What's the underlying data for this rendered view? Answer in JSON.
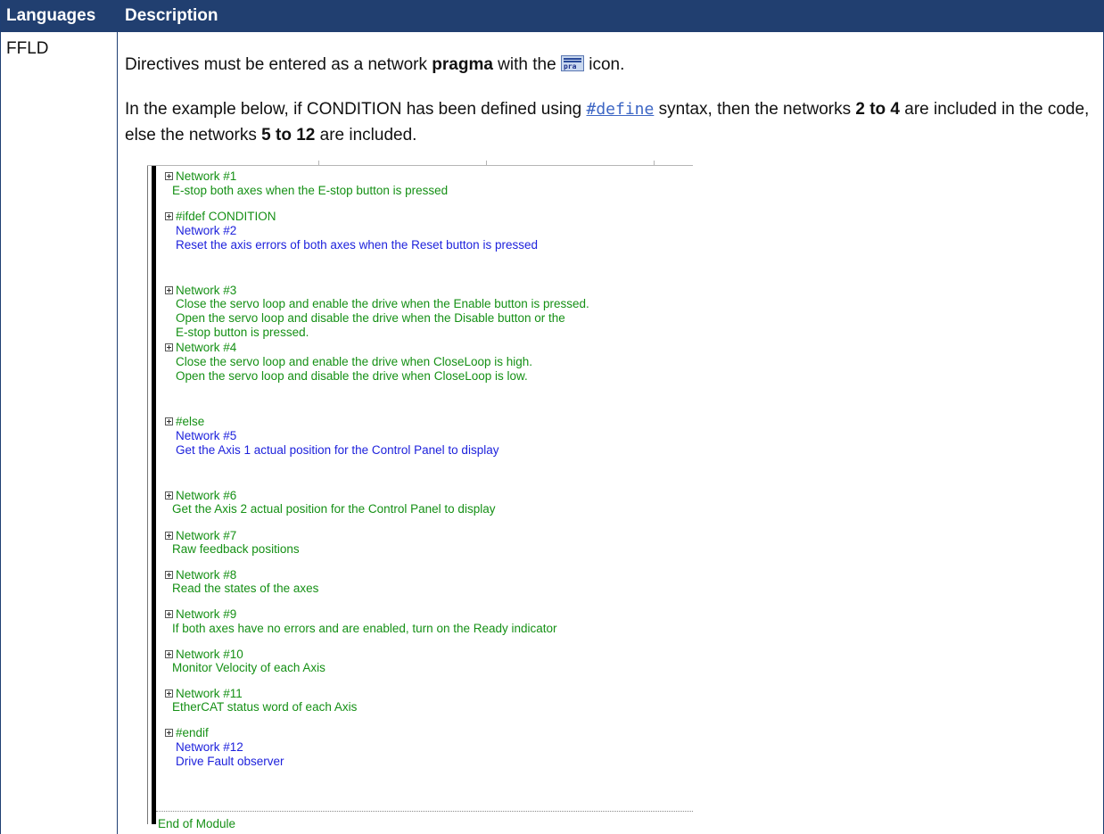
{
  "table": {
    "headers": [
      "Languages",
      "Description"
    ],
    "language": "FFLD",
    "p1": {
      "pre": "Directives must be entered as a network ",
      "bold": "pragma",
      "post_a": " with the ",
      "post_b": " icon.",
      "icon_text": "pra"
    },
    "p2": {
      "t1": "In the example below, if CONDITION has been defined using ",
      "link": "#define",
      "t2": " syntax, then the networks ",
      "b1": "2 to 4",
      "t3": " are included in the code, else the networks ",
      "b2": "5 to 12",
      "t4": " are included."
    }
  },
  "editor": {
    "items": [
      {
        "head": "Network #1",
        "lines": [
          "E-stop both axes when the E-stop button is pressed"
        ],
        "color": "green",
        "indent": "small"
      },
      {
        "head": "#ifdef CONDITION",
        "lines": [
          "Network #2",
          "Reset the axis errors of both axes when the Reset button is pressed"
        ],
        "color": "blue",
        "indent": "large"
      },
      {
        "head": "Network #3",
        "lines": [
          "Close the servo loop and enable the drive when the Enable button is pressed.",
          "Open the servo loop and disable the drive when the Disable button or the",
          "E-stop button is pressed."
        ],
        "color": "green",
        "indent": "large"
      },
      {
        "head": "Network #4",
        "lines": [
          "Close the servo loop and enable the drive when CloseLoop is high.",
          "Open the servo loop and disable the drive when CloseLoop is low."
        ],
        "color": "green",
        "indent": "large"
      },
      {
        "head": "#else",
        "lines": [
          "Network #5",
          "Get the Axis 1 actual position for the Control Panel to display"
        ],
        "color": "blue",
        "indent": "large"
      },
      {
        "head": "Network #6",
        "lines": [
          "Get the Axis 2 actual position for the Control Panel to display"
        ],
        "color": "green",
        "indent": "small"
      },
      {
        "head": "Network #7",
        "lines": [
          "Raw feedback positions"
        ],
        "color": "green",
        "indent": "small"
      },
      {
        "head": "Network #8",
        "lines": [
          "Read the states of the axes"
        ],
        "color": "green",
        "indent": "small"
      },
      {
        "head": "Network #9",
        "lines": [
          "If both axes have no errors and are enabled, turn on the Ready indicator"
        ],
        "color": "green",
        "indent": "small"
      },
      {
        "head": "Network #10",
        "lines": [
          "Monitor Velocity of each Axis"
        ],
        "color": "green",
        "indent": "small"
      },
      {
        "head": "Network #11",
        "lines": [
          "EtherCAT status word of each Axis"
        ],
        "color": "green",
        "indent": "small"
      },
      {
        "head": "#endif",
        "lines": [
          "Network #12",
          "Drive Fault observer"
        ],
        "color": "blue",
        "indent": "large"
      }
    ],
    "end_text": "End of Module"
  }
}
